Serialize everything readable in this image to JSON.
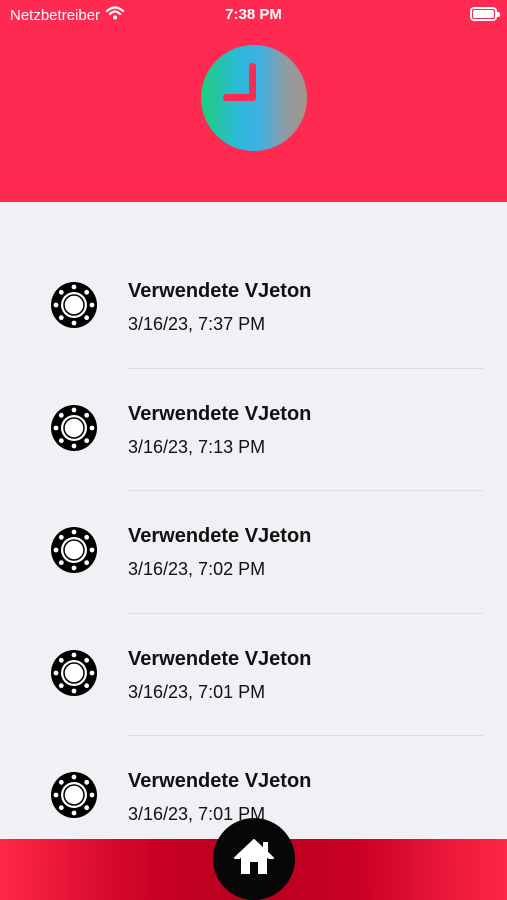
{
  "status_bar": {
    "carrier": "Netzbetreiber",
    "time": "7:38 PM",
    "wifi_icon": "wifi-icon",
    "battery_icon": "battery-icon"
  },
  "header": {
    "background_color": "#ff2a52",
    "logo_icon": "clock-icon"
  },
  "list": {
    "items": [
      {
        "title": "Verwendete VJeton",
        "date": "3/16/23, 7:37 PM",
        "icon": "token-icon"
      },
      {
        "title": "Verwendete VJeton",
        "date": "3/16/23, 7:13 PM",
        "icon": "token-icon"
      },
      {
        "title": "Verwendete VJeton",
        "date": "3/16/23, 7:02 PM",
        "icon": "token-icon"
      },
      {
        "title": "Verwendete VJeton",
        "date": "3/16/23, 7:01 PM",
        "icon": "token-icon"
      },
      {
        "title": "Verwendete VJeton",
        "date": "3/16/23, 7:01 PM",
        "icon": "token-icon"
      }
    ]
  },
  "bottom_bar": {
    "home_icon": "home-icon",
    "accent_color": "#c90024"
  }
}
